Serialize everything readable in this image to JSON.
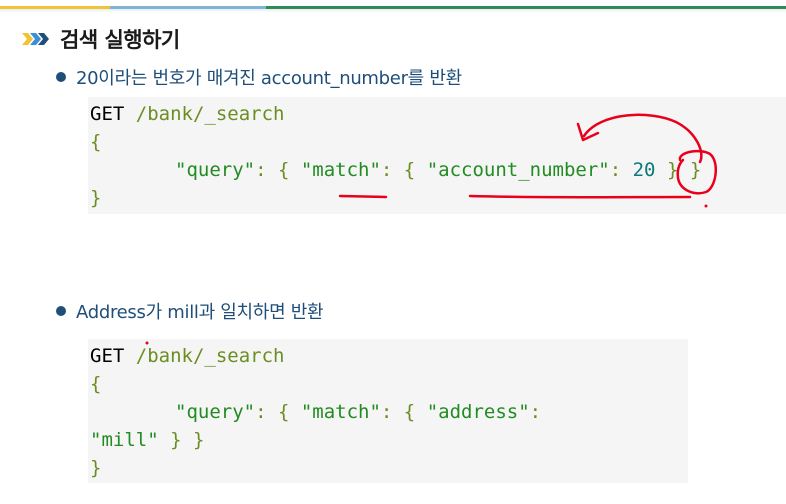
{
  "slide": {
    "title": "검색 실행하기",
    "title_icon": "chevron-arrows-icon",
    "bullets": [
      {
        "text": "20이라는 번호가 매겨진 account_number를 반환"
      },
      {
        "text": "Address가 mill과 일치하면 반환"
      }
    ],
    "code1": {
      "line1_method": "GET",
      "line1_path": " /bank/_search",
      "line2": "{",
      "line3_query": "\"query\"",
      "line3_colon1": ": { ",
      "line3_match": "\"match\"",
      "line3_colon2": ": { ",
      "line3_field": "\"account_number\"",
      "line3_colon3": ": ",
      "line3_value": "20",
      "line3_close": " } }",
      "line4": "}"
    },
    "code2": {
      "line1_method": "GET",
      "line1_path": " /bank/_search",
      "line2": "{",
      "line3_query": "\"query\"",
      "line3_colon1": ": { ",
      "line3_match": "\"match\"",
      "line3_colon2": ": { ",
      "line3_field": "\"address\"",
      "line3_colon3": ":",
      "line4_value": "\"mill\"",
      "line4_close": " } }",
      "line5": "}"
    }
  },
  "colors": {
    "bullet": "#1f4e79",
    "code_bg": "#f5f5f5",
    "string": "#228b22",
    "number": "#0a7a7a",
    "annotation": "#e8001c"
  }
}
